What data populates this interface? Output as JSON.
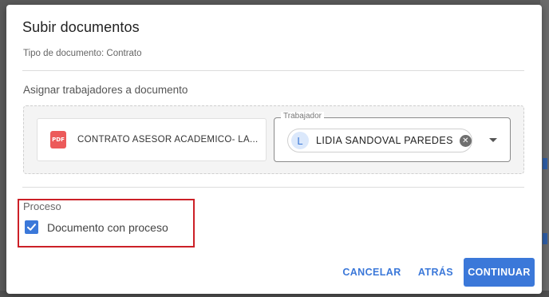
{
  "dialog": {
    "title": "Subir documentos",
    "document_type": "Tipo de documento: Contrato",
    "assign_label": "Asignar trabajadores a documento"
  },
  "document": {
    "icon_text": "PDF",
    "name": "CONTRATO ASESOR ACADEMICO- LA..."
  },
  "worker_field": {
    "legend": "Trabajador",
    "chip": {
      "avatar_letter": "L",
      "label": "LIDIA SANDOVAL PAREDES"
    }
  },
  "process": {
    "label": "Proceso",
    "checkbox_label": "Documento con proceso",
    "checked": true
  },
  "actions": {
    "cancel": "CANCELAR",
    "back": "ATRÁS",
    "continue": "CONTINUAR"
  },
  "colors": {
    "accent": "#3b78d9",
    "highlight": "#cc2027",
    "pdf_icon": "#ec5a5a"
  },
  "icons": {
    "pdf": "pdf-icon",
    "remove_chip": "close-circle-icon",
    "dropdown": "chevron-down-icon",
    "checkbox": "checkmark-icon"
  }
}
